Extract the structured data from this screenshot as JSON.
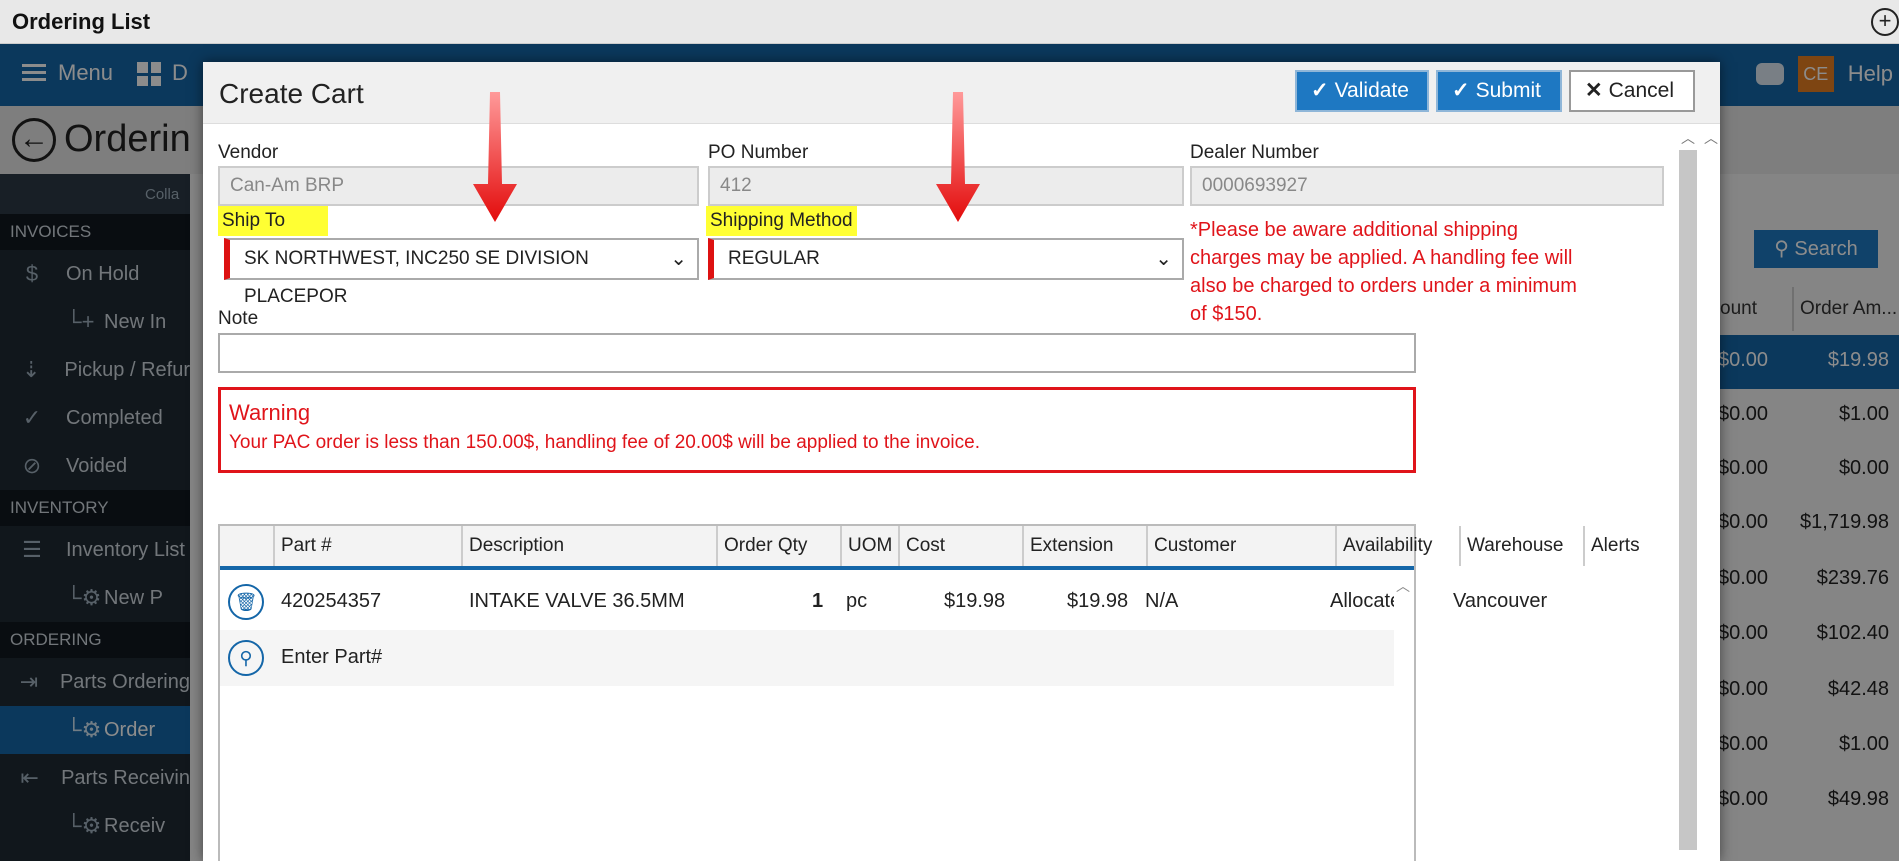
{
  "window": {
    "title": "Ordering List",
    "add_symbol": "+"
  },
  "appbar": {
    "menu_label": "Menu",
    "partial_label": "D",
    "user_initials": "CE",
    "help_label": "Help"
  },
  "page": {
    "title": "Orderin",
    "back_icon": "back-arrow-icon"
  },
  "sidebar": {
    "collapse_label": "Colla",
    "sections": [
      {
        "title": "INVOICES",
        "items": [
          {
            "label": "On Hold",
            "icon": "dollar-icon",
            "sub": false
          },
          {
            "label": "New In",
            "icon": "plus-icon",
            "sub": true
          },
          {
            "label": "Pickup / Refur",
            "icon": "pickup-icon",
            "sub": false
          },
          {
            "label": "Completed",
            "icon": "check-icon",
            "sub": false
          },
          {
            "label": "Voided",
            "icon": "void-icon",
            "sub": false
          }
        ]
      },
      {
        "title": "INVENTORY",
        "items": [
          {
            "label": "Inventory List",
            "icon": "list-icon",
            "sub": false
          },
          {
            "label": "New P",
            "icon": "gear-icon",
            "sub": true
          }
        ]
      },
      {
        "title": "ORDERING",
        "items": [
          {
            "label": "Parts Ordering",
            "icon": "order-icon",
            "sub": false
          },
          {
            "label": "Order",
            "icon": "gear-icon",
            "sub": true,
            "active": true
          },
          {
            "label": "Parts Receivin",
            "icon": "receive-icon",
            "sub": false
          },
          {
            "label": "Receiv",
            "icon": "gear-icon",
            "sub": true
          }
        ]
      }
    ]
  },
  "background_list": {
    "search_label": "Search",
    "col_amount": "ount",
    "col_order_amount": "Order Am...",
    "rows": [
      {
        "a": "$0.00",
        "b": "$19.98",
        "selected": true
      },
      {
        "a": "$0.00",
        "b": "$1.00"
      },
      {
        "a": "$0.00",
        "b": "$0.00"
      },
      {
        "a": "$0.00",
        "b": "$1,719.98"
      },
      {
        "a": "$0.00",
        "b": "$239.76"
      },
      {
        "a": "$0.00",
        "b": "$102.40"
      },
      {
        "a": "$0.00",
        "b": "$42.48"
      },
      {
        "a": "$0.00",
        "b": "$1.00"
      },
      {
        "a": "$0.00",
        "b": "$49.98"
      }
    ]
  },
  "modal": {
    "title": "Create Cart",
    "buttons": {
      "validate": "Validate",
      "submit": "Submit",
      "cancel": "Cancel"
    },
    "vendor": {
      "label": "Vendor",
      "value": "Can-Am BRP"
    },
    "po_number": {
      "label": "PO Number",
      "value": "412"
    },
    "dealer_number": {
      "label": "Dealer Number",
      "value": "0000693927"
    },
    "ship_to": {
      "label": "Ship To",
      "value": "SK NORTHWEST, INC250 SE DIVISION PLACEPOR"
    },
    "shipping_method": {
      "label": "Shipping Method",
      "value": "REGULAR"
    },
    "shipping_notice": "*Please be aware additional shipping charges may be applied. A handling fee will also be charged to orders under a minimum of $150.",
    "note": {
      "label": "Note",
      "value": ""
    },
    "warning": {
      "title": "Warning",
      "message": "Your PAC order is less than 150.00$, handling fee of 20.00$ will be applied to the invoice."
    },
    "grid": {
      "columns": [
        "",
        "Part #",
        "Description",
        "Order Qty",
        "UOM",
        "Cost",
        "Extension",
        "Customer",
        "Availability",
        "Warehouse",
        "Alerts"
      ],
      "rows": [
        {
          "part": "420254357",
          "description": "INTAKE VALVE 36.5MM",
          "qty": "1",
          "uom": "pc",
          "cost": "$19.98",
          "extension": "$19.98",
          "customer": "N/A",
          "availability": "Allocated",
          "warehouse": "Vancouver",
          "alerts": ""
        }
      ],
      "entry_placeholder": "Enter Part#"
    }
  },
  "colors": {
    "accent": "#1466a8",
    "warning": "#e0141a",
    "highlight": "#ffff33"
  }
}
